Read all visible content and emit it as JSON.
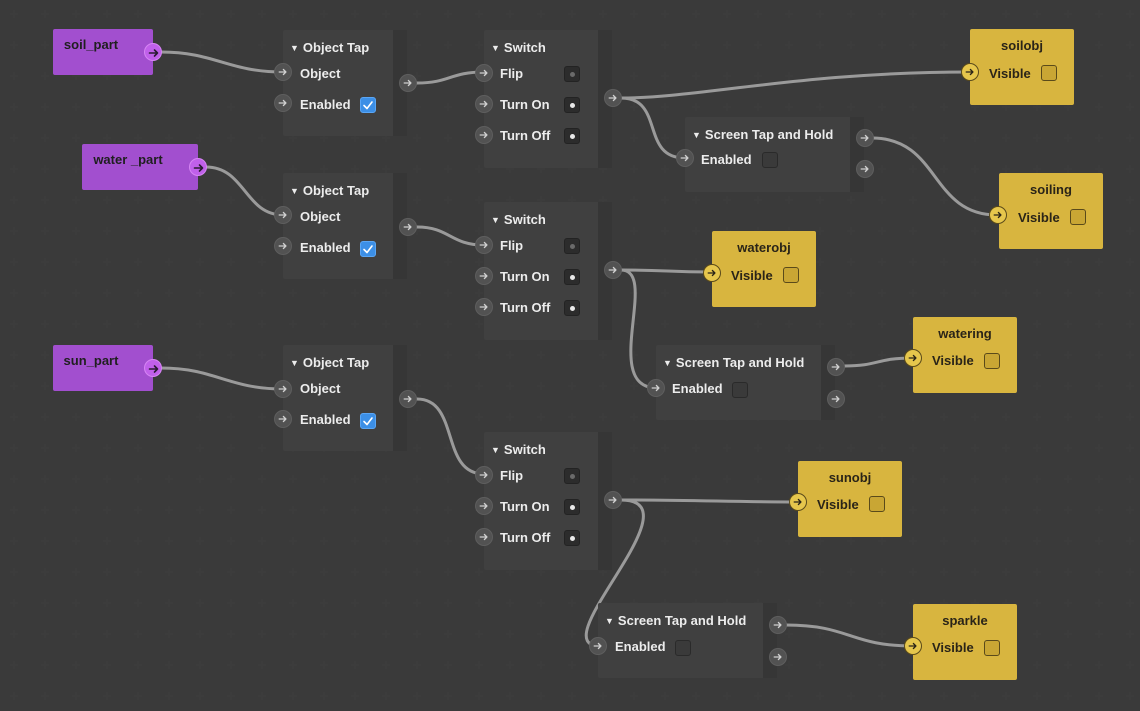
{
  "theme": {
    "background": "#2d2d2d",
    "wire": "#9a9a9a",
    "purple_node": "#a24fcf",
    "dark_node": "#404040",
    "yellow_node": "#d8b53f",
    "checkbox_checked": "#3c8fe6"
  },
  "texts": {
    "soil_part": "soil_part",
    "water_part": "water _part",
    "sun_part": "sun_part",
    "object_tap": "Object Tap",
    "object": "Object",
    "enabled": "Enabled",
    "switch": "Switch",
    "flip": "Flip",
    "turn_on": "Turn On",
    "turn_off": "Turn Off",
    "screen_tap_hold": "Screen Tap and Hold",
    "visible": "Visible",
    "soilobj": "soilobj",
    "soiling": "soiling",
    "waterobj": "waterobj",
    "watering": "watering",
    "sunobj": "sunobj",
    "sparkle": "sparkle",
    "triangle": "▼"
  },
  "states": {
    "object_tap_enabled": [
      true,
      true,
      true
    ],
    "screen_tap_hold_enabled": [
      false,
      false,
      false
    ],
    "visible_checked": [
      false,
      false,
      false,
      false,
      false,
      false
    ]
  },
  "icons": {
    "port": "arrow-right-icon",
    "collapse": "triangle-down-icon",
    "check": "checkmark-icon"
  }
}
